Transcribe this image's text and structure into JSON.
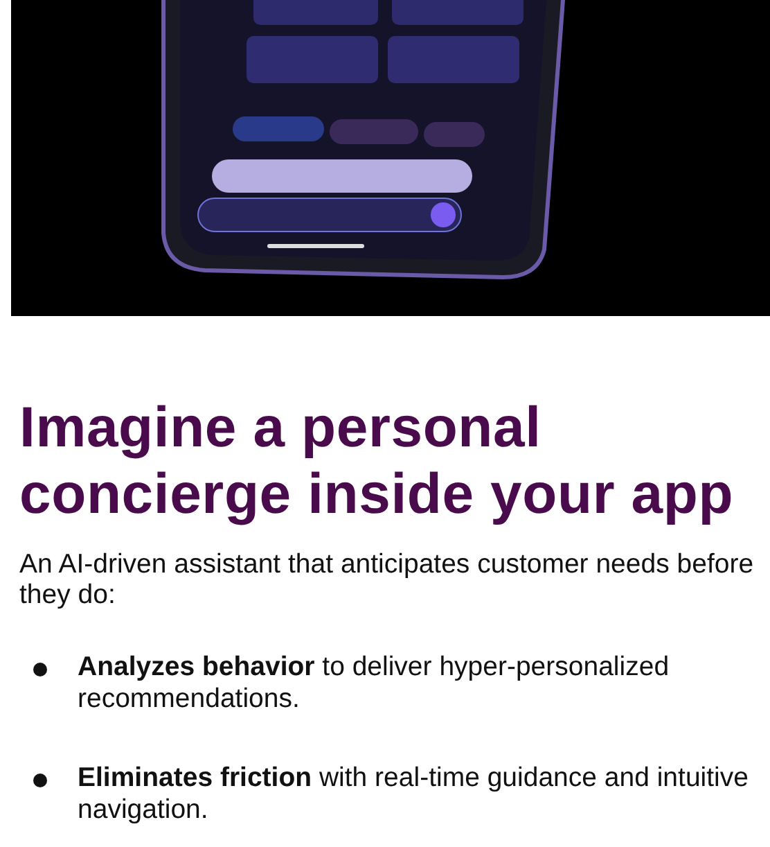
{
  "heading": "Imagine a personal concierge inside your app",
  "intro": "An AI-driven assistant that anticipates customer needs before they do:",
  "bullets": [
    {
      "text": "**Analyzes behavior** to deliver hyper-personalized recommendations."
    },
    {
      "text": "**Eliminates friction** with real-time guidance and intuitive navigation."
    }
  ]
}
